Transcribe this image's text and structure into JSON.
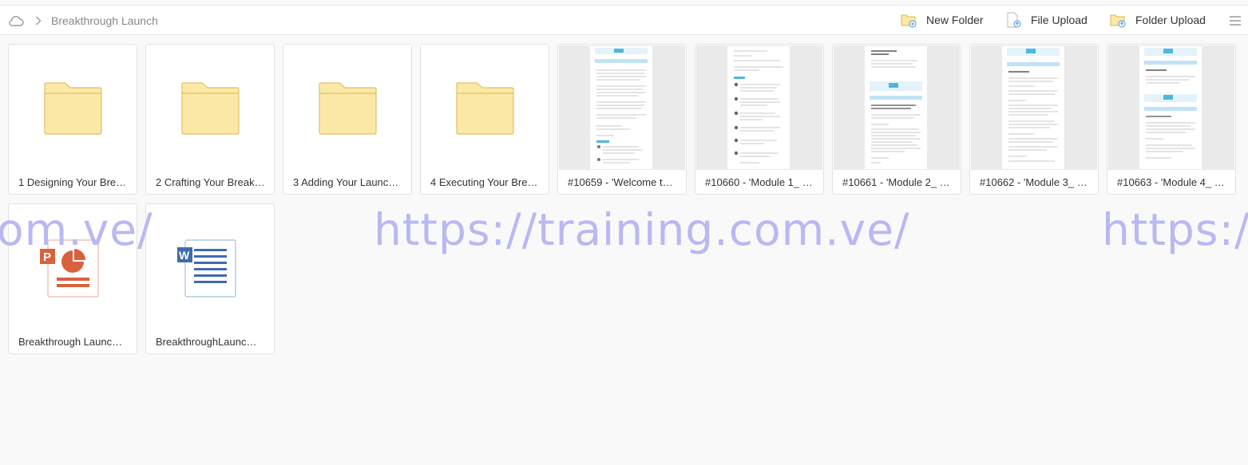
{
  "breadcrumb": {
    "current": "Breakthrough Launch"
  },
  "toolbar": {
    "new_folder": "New Folder",
    "file_upload": "File Upload",
    "folder_upload": "Folder Upload"
  },
  "items": [
    {
      "label": "1 Designing Your Bre…",
      "kind": "folder"
    },
    {
      "label": "2 Crafting Your Break…",
      "kind": "folder"
    },
    {
      "label": "3 Adding Your Launc…",
      "kind": "folder"
    },
    {
      "label": "4 Executing Your Bre…",
      "kind": "folder"
    },
    {
      "label": "#10659 - 'Welcome t…",
      "kind": "document"
    },
    {
      "label": "#10660 - 'Module 1_ …",
      "kind": "document"
    },
    {
      "label": "#10661 - 'Module 2_ …",
      "kind": "document"
    },
    {
      "label": "#10662 - 'Module 3_ …",
      "kind": "document"
    },
    {
      "label": "#10663 - 'Module 4_ …",
      "kind": "document"
    },
    {
      "label": "Breakthrough Launc…",
      "kind": "powerpoint"
    },
    {
      "label": "BreakthroughLaunc…",
      "kind": "word"
    }
  ],
  "watermark": {
    "left_text": "om.ve/",
    "center_text": "https://training.com.ve/",
    "right_text": "https://"
  },
  "colors": {
    "folder_fill": "#fce8a6",
    "folder_stroke": "#e0c062",
    "ppt_orange": "#d9613e",
    "word_blue": "#3f6bad",
    "watermark": "#b9b8f2",
    "thumb_accent": "#4fb6e0"
  }
}
